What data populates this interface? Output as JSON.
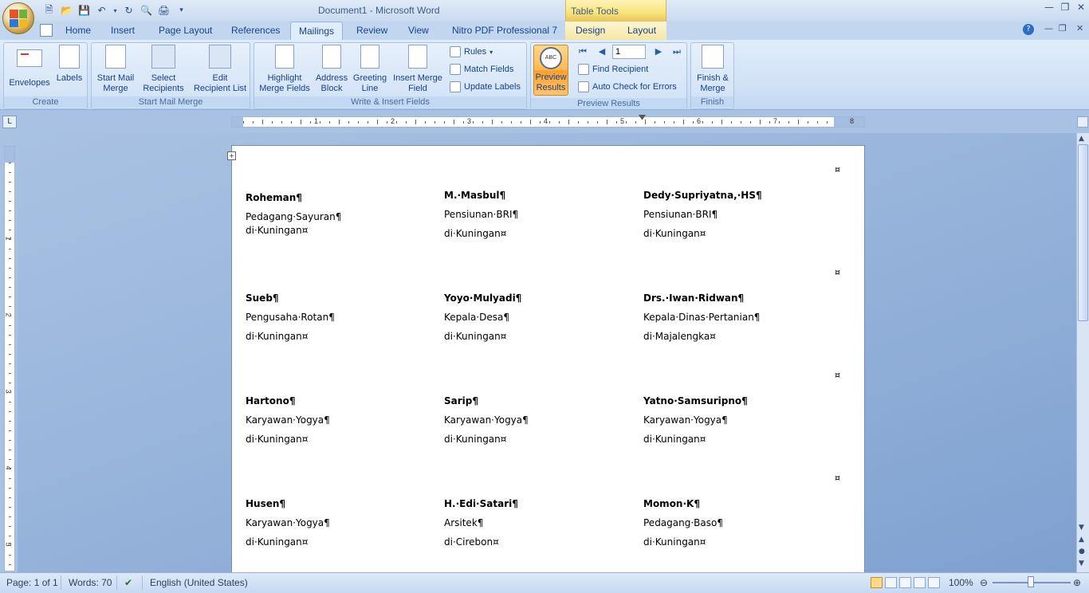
{
  "window": {
    "title": "Document1 - Microsoft Word",
    "context_tab_group": "Table Tools"
  },
  "tabs": [
    "Home",
    "Insert",
    "Page Layout",
    "References",
    "Mailings",
    "Review",
    "View",
    "Nitro PDF Professional 7",
    "Design",
    "Layout"
  ],
  "active_tab": "Mailings",
  "ribbon": {
    "create": {
      "label": "Create",
      "envelopes": "Envelopes",
      "labels": "Labels"
    },
    "start_mail_merge": {
      "label": "Start Mail Merge",
      "start_l1": "Start Mail",
      "start_l2": "Merge",
      "select_l1": "Select",
      "select_l2": "Recipients",
      "edit_l1": "Edit",
      "edit_l2": "Recipient List"
    },
    "write_insert": {
      "label": "Write & Insert Fields",
      "highlight_l1": "Highlight",
      "highlight_l2": "Merge Fields",
      "address_l1": "Address",
      "address_l2": "Block",
      "greeting_l1": "Greeting",
      "greeting_l2": "Line",
      "insert_l1": "Insert Merge",
      "insert_l2": "Field",
      "rules": "Rules",
      "match_fields": "Match Fields",
      "update_labels": "Update Labels"
    },
    "preview": {
      "label": "Preview Results",
      "preview_l1": "Preview",
      "preview_l2": "Results",
      "record": "1",
      "find_recipient": "Find Recipient",
      "auto_check": "Auto Check for Errors"
    },
    "finish": {
      "label": "Finish",
      "finish_l1": "Finish &",
      "finish_l2": "Merge"
    }
  },
  "ruler": {
    "h_numbers": [
      "1",
      "2",
      "3",
      "4",
      "5",
      "6",
      "7",
      "8"
    ],
    "v_numbers": [
      "1",
      "2",
      "3",
      "4",
      "5"
    ]
  },
  "labels": [
    {
      "name": "Roheman¶",
      "line2": "Pedagang·Sayuran¶",
      "line3": "di·Kuningan¤"
    },
    {
      "name": "M.·Masbul¶",
      "line2": "Pensiunan·BRI¶",
      "line3": "di·Kuningan¤"
    },
    {
      "name": "Dedy·Supriyatna,·HS¶",
      "line2": "Pensiunan·BRI¶",
      "line3": "di·Kuningan¤"
    },
    {
      "name": "Sueb¶",
      "line2": "Pengusaha·Rotan¶",
      "line3": "di·Kuningan¤"
    },
    {
      "name": "Yoyo·Mulyadi¶",
      "line2": "Kepala·Desa¶",
      "line3": "di·Kuningan¤"
    },
    {
      "name": "Drs.·Iwan·Ridwan¶",
      "line2": "Kepala·Dinas·Pertanian¶",
      "line3": "di·Majalengka¤"
    },
    {
      "name": "Hartono¶",
      "line2": "Karyawan·Yogya¶",
      "line3": "di·Kuningan¤"
    },
    {
      "name": "Sarip¶",
      "line2": "Karyawan·Yogya¶",
      "line3": "di·Kuningan¤"
    },
    {
      "name": "Yatno·Samsuripno¶",
      "line2": "Karyawan·Yogya¶",
      "line3": "di·Kuningan¤"
    },
    {
      "name": "Husen¶",
      "line2": "Karyawan·Yogya¶",
      "line3": "di·Kuningan¤"
    },
    {
      "name": "H.·Edi·Satari¶",
      "line2": "Arsitek¶",
      "line3": "di·Cirebon¤"
    },
    {
      "name": "Momon·K¶",
      "line2": "Pedagang·Baso¶",
      "line3": "di·Kuningan¤"
    }
  ],
  "row_end_mark": "¤",
  "status": {
    "page": "Page: 1 of 1",
    "words": "Words: 70",
    "language": "English (United States)",
    "zoom": "100%"
  },
  "colors": {
    "accent": "#15428b",
    "preview_active": "#ffb84d",
    "background": "#a9c2e3"
  }
}
